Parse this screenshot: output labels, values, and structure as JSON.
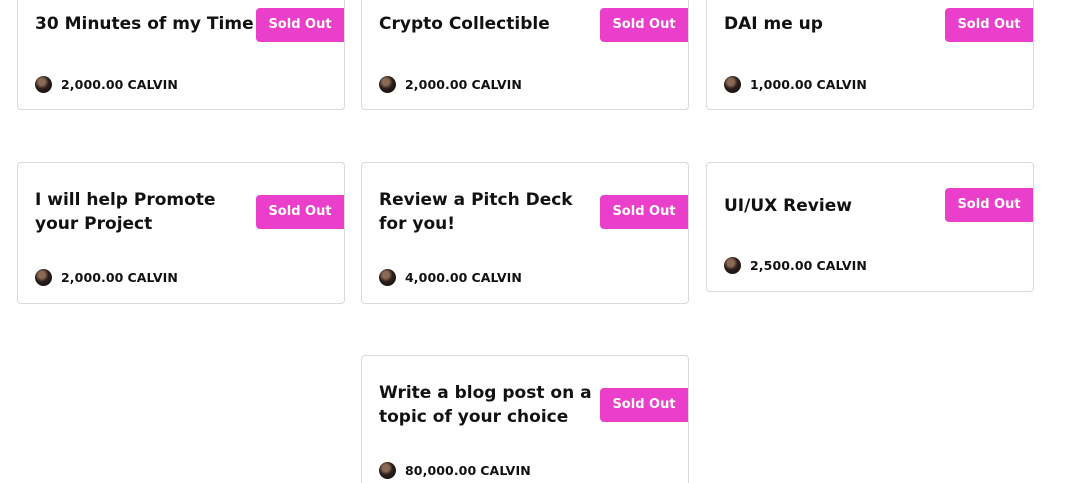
{
  "cards": [
    {
      "title": "30 Minutes of my Time",
      "status": "Sold Out",
      "amount": "2,000.00",
      "currency": "CALVIN"
    },
    {
      "title": "Crypto Collectible",
      "status": "Sold Out",
      "amount": "2,000.00",
      "currency": "CALVIN"
    },
    {
      "title": "DAI me up",
      "status": "Sold Out",
      "amount": "1,000.00",
      "currency": "CALVIN"
    },
    {
      "title": "I will help Promote your Project",
      "status": "Sold Out",
      "amount": "2,000.00",
      "currency": "CALVIN"
    },
    {
      "title": "Review a Pitch Deck for you!",
      "status": "Sold Out",
      "amount": "4,000.00",
      "currency": "CALVIN"
    },
    {
      "title": "UI/UX Review",
      "status": "Sold Out",
      "amount": "2,500.00",
      "currency": "CALVIN"
    },
    {
      "title": "Write a blog post on a topic of your choice",
      "status": "Sold Out",
      "amount": "80,000.00",
      "currency": "CALVIN"
    }
  ],
  "colors": {
    "badge": "#ea3fca",
    "border": "#d9d9de",
    "text": "#111111"
  }
}
